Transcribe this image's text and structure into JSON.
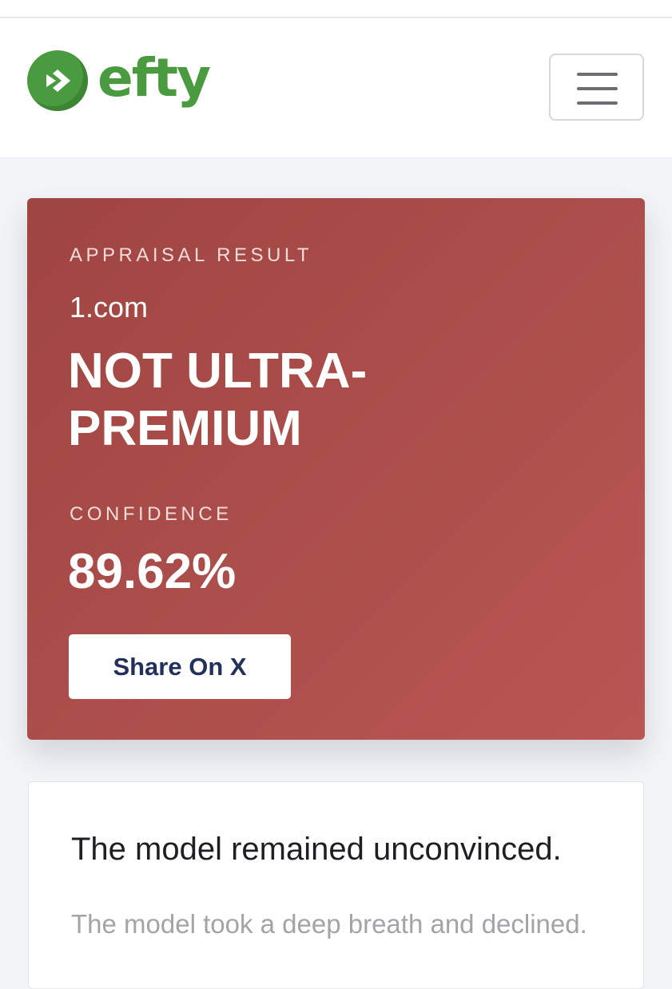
{
  "header": {
    "logo_text": "efty",
    "logo_icon": "efty-arrow-logo-icon",
    "menu_icon": "hamburger-menu-icon"
  },
  "result": {
    "eyebrow": "APPRAISAL RESULT",
    "domain": "1.com",
    "verdict": "NOT ULTRA-PREMIUM",
    "confidence_label": "CONFIDENCE",
    "confidence_value": "89.62%",
    "share_label": "Share On X"
  },
  "message": {
    "title": "The model remained unconvinced.",
    "body": "The model took a deep breath and declined."
  },
  "colors": {
    "brand_green": "#4a9a3f",
    "result_card": "#ac4e4b",
    "share_text": "#23305a",
    "page_background": "#f3f4f7"
  }
}
